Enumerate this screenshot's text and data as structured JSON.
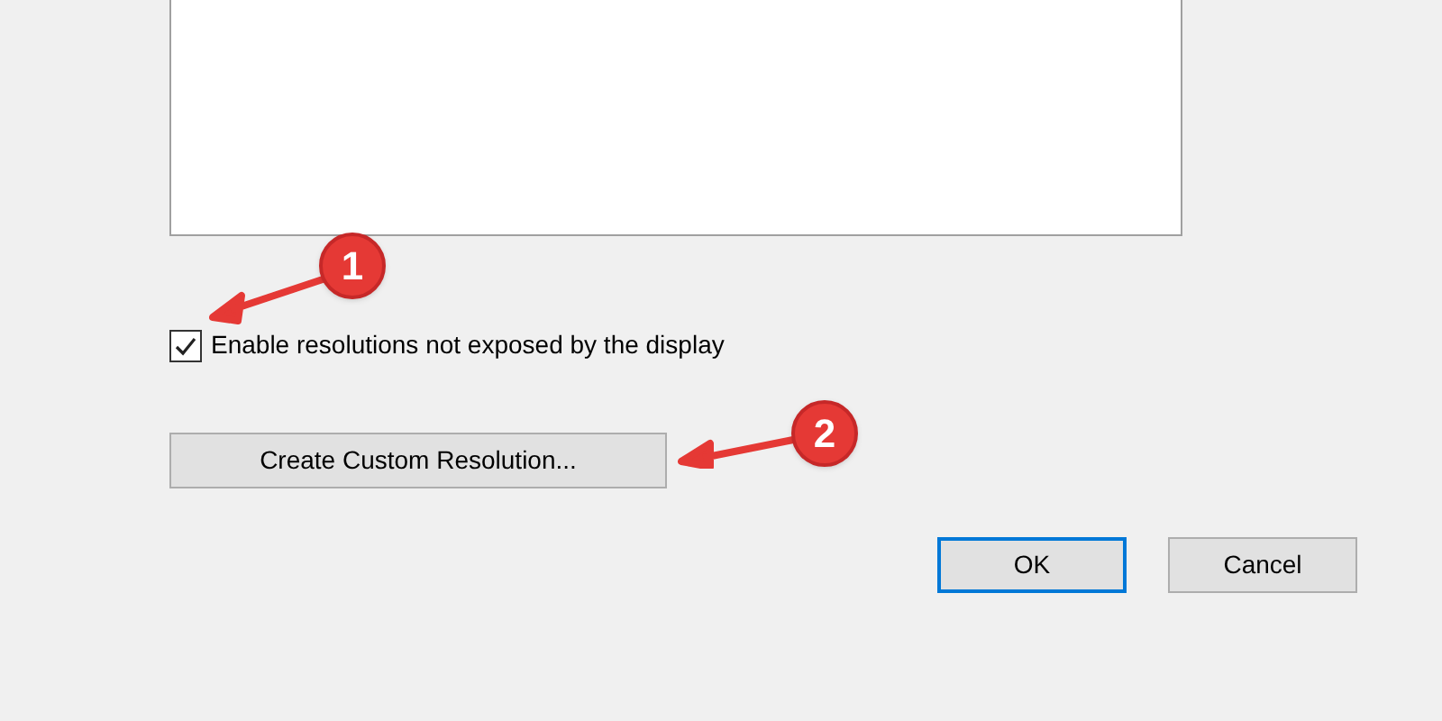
{
  "checkbox": {
    "label": "Enable resolutions not exposed by the display",
    "checked": true
  },
  "custom_button": "Create Custom Resolution...",
  "dialog_buttons": [
    {
      "label": "OK",
      "selected": true
    },
    {
      "label": "Cancel",
      "selected": false
    }
  ],
  "annotations": [
    "1",
    "2"
  ]
}
